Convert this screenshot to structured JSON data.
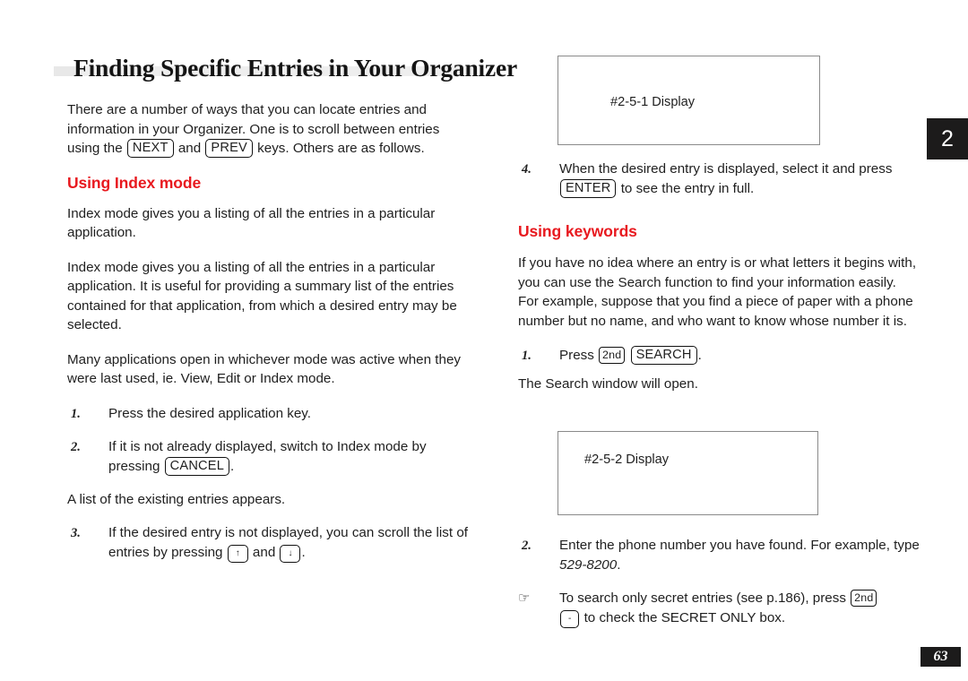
{
  "page": {
    "title": "Finding Specific Entries in Your Organizer",
    "chapter_tab": "2",
    "folio": "63",
    "accent_color": "#e8191f",
    "tab_color": "#1c1b1b"
  },
  "left_column": {
    "intro": {
      "part1": "There are a number of ways that you can locate entries and information in your Organizer. One is to scroll between entries using the ",
      "key_next": "NEXT",
      "part2": " and ",
      "key_prev": "PREV",
      "part3": " keys. Others are as follows."
    },
    "index_heading": "Using Index mode",
    "para_1": "Index mode gives you a listing of all the entries in a particular application.",
    "para_2": "Index mode gives you a listing of all the entries in a particular application. It is useful for providing a summary list of the entries contained for that application, from which a desired entry may be selected.",
    "para_3": "Many applications open in whichever mode was active when they were last used, ie. View, Edit or Index mode.",
    "steps": [
      {
        "num": "1.",
        "text": "Press the desired application key."
      },
      {
        "num": "2.",
        "text_before": "If it is not already displayed, switch to Index mode by pressing ",
        "key": "CANCEL",
        "text_after": "."
      },
      {
        "num": "3.",
        "text_before": "If the desired entry is not displayed, you can scroll the list of entries by pressing ",
        "key_up": "↑",
        "text_mid": " and ",
        "key_down": "↓",
        "text_after": "."
      }
    ],
    "note_after_step2": "A list of the existing entries appears."
  },
  "right_column": {
    "display_1": {
      "label": "#2-5-1 Display"
    },
    "step_4": {
      "num": "4.",
      "text_before": "When the desired entry is displayed, select it and press ",
      "key": "ENTER",
      "text_after": " to see the entry in full."
    },
    "keywords_heading": "Using keywords",
    "para_1": "If you have no idea where an entry is or what letters it begins with, you can use the Search function to find your information easily. For example, suppose that you find a piece of paper with a phone number but no name, and who want to know whose number it is.",
    "step_1": {
      "num": "1.",
      "text_before": "Press ",
      "key_2nd": "2nd",
      "key_search": "SEARCH",
      "text_after": "."
    },
    "note_search_window": "The Search window will open.",
    "display_2": {
      "label": "#2-5-2 Display"
    },
    "step_2": {
      "num": "2.",
      "text_before": "Enter the phone number you have found. For example, type ",
      "emphasis": "529-8200",
      "text_after": "."
    },
    "tip": {
      "marker": "☞",
      "text_before": "To search only secret entries (see p.186), press ",
      "key_2nd": "2nd",
      "key_minus": "-",
      "text_after": " to check the SECRET ONLY box."
    }
  }
}
